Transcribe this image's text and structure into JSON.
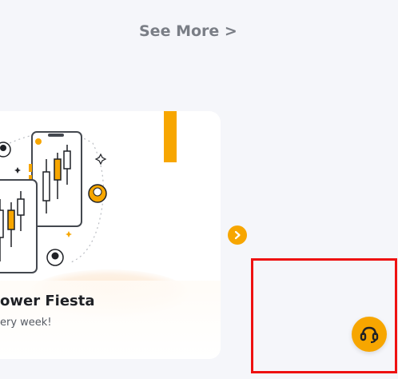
{
  "see_more": {
    "label": "See More >"
  },
  "promo_card": {
    "title": "ower Fiesta",
    "subtitle": "ery week!",
    "illustration": "trading-phones-candlestick-illustration"
  },
  "carousel": {
    "next_icon": "chevron-right-icon"
  },
  "support": {
    "icon": "headset-icon"
  },
  "colors": {
    "background": "#f5f6fa",
    "accent": "#f7a600",
    "card": "#ffffff",
    "highlight_border": "#ee1111",
    "muted_text": "#7a7e86"
  }
}
